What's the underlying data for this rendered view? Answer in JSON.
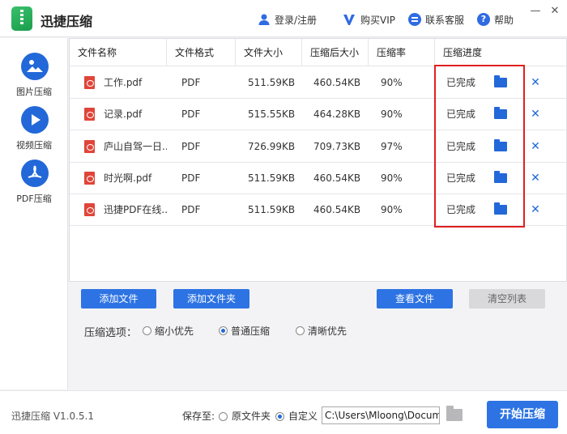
{
  "app": {
    "title": "迅捷压缩",
    "version": "迅捷压缩 V1.0.5.1"
  },
  "titlebar": {
    "login": "登录/注册",
    "vip": "购买VIP",
    "service": "联系客服",
    "help": "帮助",
    "min": "—",
    "close": "✕"
  },
  "sidebar": {
    "items": [
      {
        "label": "图片压缩",
        "icon": "image-icon"
      },
      {
        "label": "视频压缩",
        "icon": "play-icon"
      },
      {
        "label": "PDF压缩",
        "icon": "pdf-icon"
      }
    ]
  },
  "table": {
    "headers": [
      "文件名称",
      "文件格式",
      "文件大小",
      "压缩后大小",
      "压缩率",
      "压缩进度"
    ],
    "rows": [
      {
        "name": "工作.pdf",
        "format": "PDF",
        "size": "511.59KB",
        "compressed": "460.54KB",
        "ratio": "90%",
        "status": "已完成"
      },
      {
        "name": "记录.pdf",
        "format": "PDF",
        "size": "515.55KB",
        "compressed": "464.28KB",
        "ratio": "90%",
        "status": "已完成"
      },
      {
        "name": "庐山自驾一日...",
        "format": "PDF",
        "size": "726.99KB",
        "compressed": "709.73KB",
        "ratio": "97%",
        "status": "已完成"
      },
      {
        "name": "时光啊.pdf",
        "format": "PDF",
        "size": "511.59KB",
        "compressed": "460.54KB",
        "ratio": "90%",
        "status": "已完成"
      },
      {
        "name": "迅捷PDF在线...",
        "format": "PDF",
        "size": "511.59KB",
        "compressed": "460.54KB",
        "ratio": "90%",
        "status": "已完成"
      }
    ],
    "remove": "✕"
  },
  "actions": {
    "add_file": "添加文件",
    "add_folder": "添加文件夹",
    "view_file": "查看文件",
    "clear_list": "清空列表"
  },
  "options": {
    "label": "压缩选项：",
    "choices": [
      "缩小优先",
      "普通压缩",
      "清晰优先"
    ],
    "selected": "普通压缩"
  },
  "bottom": {
    "save_to": "保存至:",
    "original_folder": "原文件夹",
    "custom": "自定义",
    "path": "C:\\Users\\Mloong\\Documents",
    "start": "开始压缩"
  },
  "colors": {
    "accent": "#2d73e3",
    "highlight": "#e02020"
  }
}
